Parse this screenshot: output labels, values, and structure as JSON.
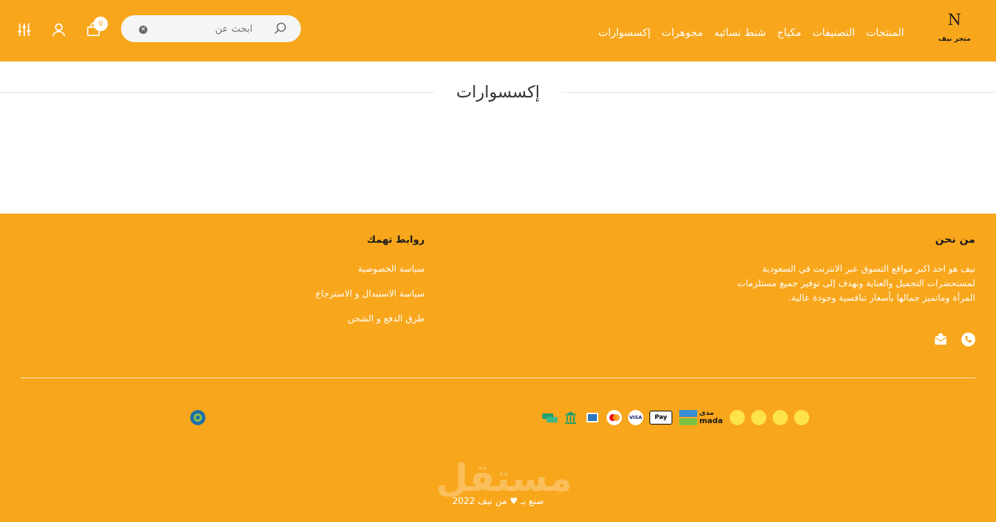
{
  "header": {
    "logo_mark": "N",
    "logo_text": "متجر نيف",
    "nav": [
      "المنتجات",
      "التصنيفات",
      "مكياج",
      "شنط نسائيه",
      "مجوهرات",
      "إكسسوارات"
    ],
    "search_placeholder": "ابحث عن",
    "cart_count": "0",
    "icons": [
      "search-icon",
      "clear-icon",
      "cart-icon",
      "user-icon",
      "filter-icon"
    ]
  },
  "page": {
    "title": "إكسسوارات"
  },
  "footer": {
    "about_title": "من نحن",
    "about_text": "نيف هو احد اكبر مواقع التسوق عبر الانترنت في السعودية لمستحضرات التجميل والعناية ونهدف إلى توفير جميع مستلزمات المرأة وماتميز جمالها بأسعار تنافسية وجودة عالية.",
    "links_title": "روابط تهمك",
    "links": [
      "سياسة الخصوصية",
      "سياسة الاستبدال و الاسترجاع",
      "طرق الدفع و الشحن"
    ],
    "payment_labels": [
      "Pay",
      "VISA",
      "mada",
      "مدى"
    ],
    "copyright": "صنع بـ ♥ من نيف 2022",
    "watermark": "مستقل",
    "colors": {
      "brand": "#f8a61b",
      "text_dark": "#1b1b1b"
    }
  }
}
